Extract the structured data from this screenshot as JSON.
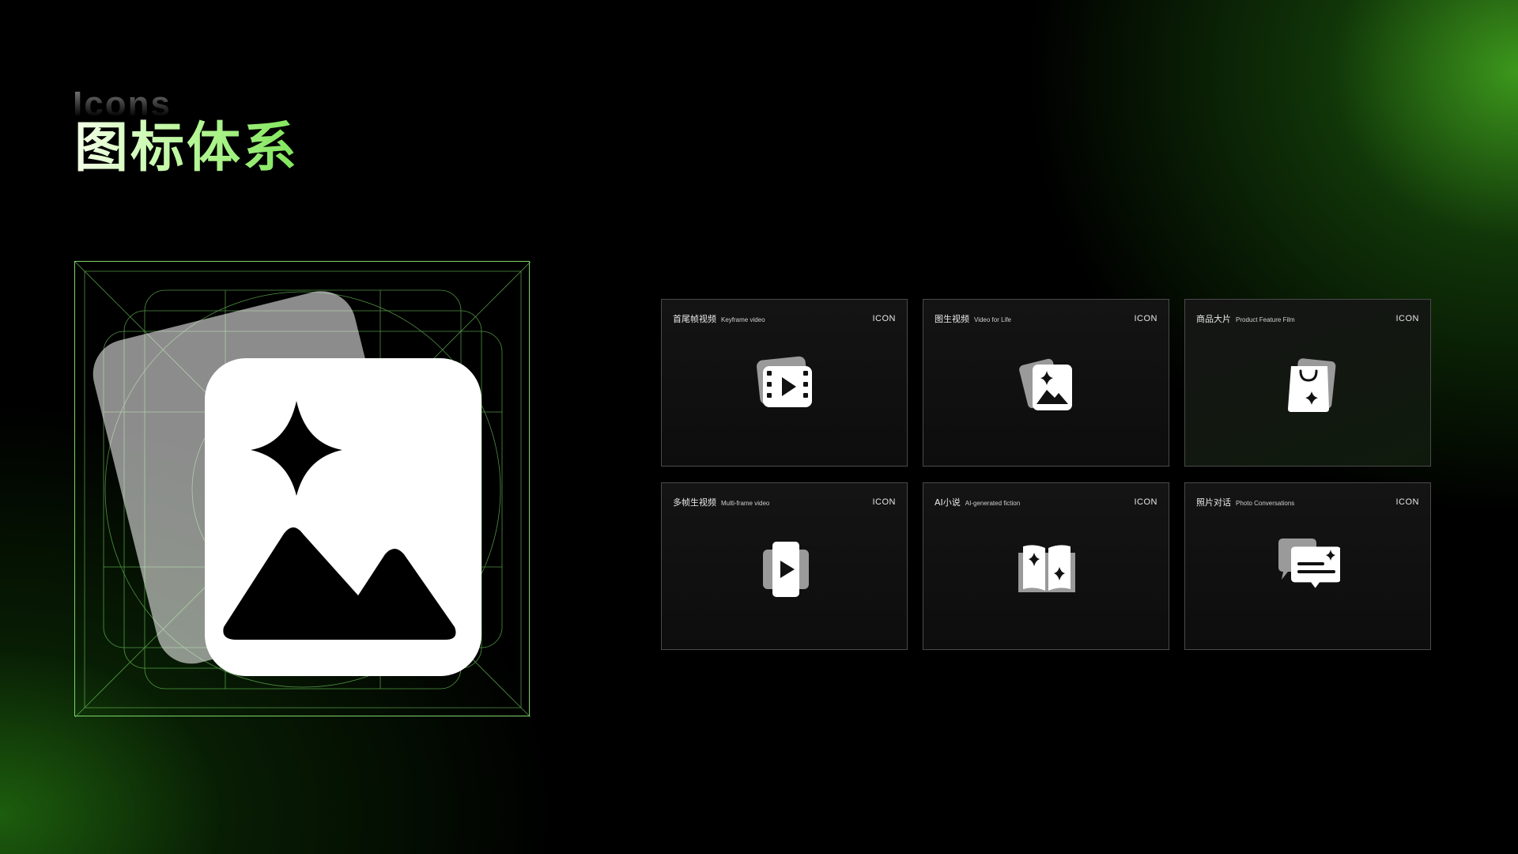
{
  "header": {
    "title_en": "Icons",
    "title_cn": "图标体系"
  },
  "hero": {
    "icon": "sparkle-image-icon"
  },
  "cards": [
    {
      "title_cn": "首尾帧视频",
      "title_en": "Keyframe video",
      "tag": "ICON",
      "icon": "film-play-icon"
    },
    {
      "title_cn": "图生视频",
      "title_en": "Video for Life",
      "tag": "ICON",
      "icon": "sparkle-image-icon"
    },
    {
      "title_cn": "商品大片",
      "title_en": "Product Feature Film",
      "tag": "ICON",
      "icon": "shopping-bag-icon"
    },
    {
      "title_cn": "多帧生视频",
      "title_en": "Multi-frame video",
      "tag": "ICON",
      "icon": "play-stack-icon"
    },
    {
      "title_cn": "AI小说",
      "title_en": "AI-generated fiction",
      "tag": "ICON",
      "icon": "sparkle-book-icon"
    },
    {
      "title_cn": "照片对话",
      "title_en": "Photo Conversations",
      "tag": "ICON",
      "icon": "chat-bubble-icon"
    }
  ],
  "colors": {
    "accent": "#7fe55a",
    "grid_line": "#7fd26a",
    "card_border": "#4a4a4a"
  }
}
